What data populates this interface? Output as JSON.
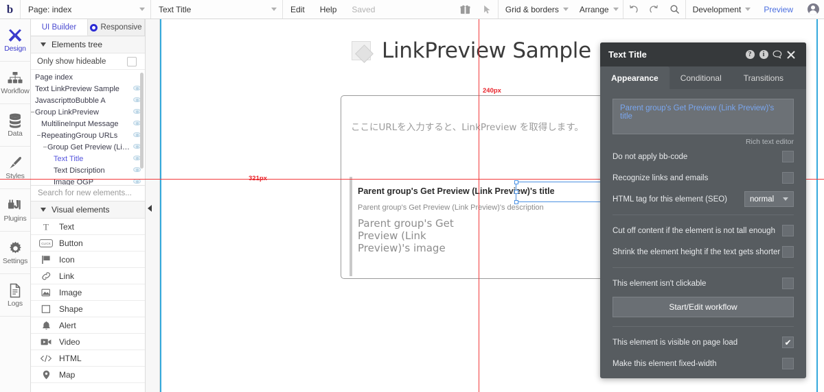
{
  "topbar": {
    "logo": "b",
    "page_select": "Page: index",
    "element_select": "Text Title",
    "edit": "Edit",
    "help": "Help",
    "saved": "Saved",
    "gift_icon": "gift-icon",
    "pointer_icon": "pointer-icon",
    "grid_borders": "Grid & borders",
    "arrange": "Arrange",
    "undo_icon": "undo-icon",
    "redo_icon": "redo-icon",
    "search_icon": "search-icon",
    "version": "Development",
    "preview": "Preview",
    "avatar": "user-avatar"
  },
  "rail": {
    "items": [
      {
        "label": "Design",
        "icon": "design-tools-icon",
        "active": true
      },
      {
        "label": "Workflow",
        "icon": "workflow-icon",
        "active": false
      },
      {
        "label": "Data",
        "icon": "database-icon",
        "active": false
      },
      {
        "label": "Styles",
        "icon": "paintbrush-icon",
        "active": false
      },
      {
        "label": "Plugins",
        "icon": "plug-icon",
        "active": false
      },
      {
        "label": "Settings",
        "icon": "gear-icon",
        "active": false
      },
      {
        "label": "Logs",
        "icon": "document-icon",
        "active": false
      }
    ]
  },
  "left_panel": {
    "tabs": [
      {
        "label": "UI Builder",
        "active": true
      },
      {
        "label": "Responsive",
        "active": false
      }
    ],
    "elements_tree_header": "Elements tree",
    "only_show_hideable": "Only show hideable",
    "tree": [
      {
        "label": "Page index",
        "depth": 0,
        "dash": false,
        "eye": false,
        "selected": false
      },
      {
        "label": "Text LinkPreview Sample",
        "depth": 0,
        "dash": false,
        "eye": true,
        "selected": false
      },
      {
        "label": "JavascripttoBubble A",
        "depth": 0,
        "dash": false,
        "eye": true,
        "selected": false
      },
      {
        "label": "Group LinkPreview",
        "depth": 0,
        "dash": true,
        "eye": true,
        "selected": false
      },
      {
        "label": "MultilineInput Message",
        "depth": 1,
        "dash": false,
        "eye": true,
        "selected": false
      },
      {
        "label": "RepeatingGroup URLs",
        "depth": 1,
        "dash": true,
        "eye": true,
        "selected": false
      },
      {
        "label": "Group Get Preview (Lin...",
        "depth": 2,
        "dash": true,
        "eye": true,
        "selected": false
      },
      {
        "label": "Text Title",
        "depth": 3,
        "dash": false,
        "eye": true,
        "selected": true
      },
      {
        "label": "Text Discription",
        "depth": 3,
        "dash": false,
        "eye": true,
        "selected": false
      },
      {
        "label": "Image OGP",
        "depth": 3,
        "dash": false,
        "eye": true,
        "selected": false
      }
    ],
    "search_placeholder": "Search for new elements...",
    "visual_elements_header": "Visual elements",
    "visual_elements": [
      {
        "label": "Text",
        "icon": "text-icon"
      },
      {
        "label": "Button",
        "icon": "button-icon"
      },
      {
        "label": "Icon",
        "icon": "flag-icon"
      },
      {
        "label": "Link",
        "icon": "link-icon"
      },
      {
        "label": "Image",
        "icon": "image-icon"
      },
      {
        "label": "Shape",
        "icon": "shape-icon"
      },
      {
        "label": "Alert",
        "icon": "bell-icon"
      },
      {
        "label": "Video",
        "icon": "video-icon"
      },
      {
        "label": "HTML",
        "icon": "code-icon"
      },
      {
        "label": "Map",
        "icon": "map-pin-icon"
      }
    ]
  },
  "canvas": {
    "page_title": "LinkPreview Sample",
    "page_title_icon": "image-placeholder-icon",
    "url_input_placeholder": "ここにURLを入力すると、LinkPreview を取得します。",
    "preview_title": "Parent group's Get Preview (Link Preview)'s title",
    "preview_description": "Parent group's Get Preview (Link Preview)'s description",
    "preview_image_text": "Parent group's Get Preview (Link Preview)'s image",
    "guide_vertical_label": "240px",
    "guide_horizontal_label": "321px",
    "guide_color": "#f2383a",
    "edge_color": "#34a9dc"
  },
  "property_panel": {
    "title": "Text Title",
    "header_icons": [
      "help-circle-icon",
      "info-circle-icon",
      "comment-icon",
      "close-icon"
    ],
    "tabs": [
      {
        "label": "Appearance",
        "active": true
      },
      {
        "label": "Conditional",
        "active": false
      },
      {
        "label": "Transitions",
        "active": false
      }
    ],
    "rich_text_value": "Parent group's Get Preview (Link Preview)'s title",
    "rich_text_caption": "Rich text editor",
    "options": [
      {
        "label": "Do not apply bb-code",
        "checked": false
      },
      {
        "label": "Recognize links and emails",
        "checked": false
      }
    ],
    "html_tag_label": "HTML tag for this element (SEO)",
    "html_tag_value": "normal",
    "options2": [
      {
        "label": "Cut off content if the element is not tall enough",
        "checked": false
      },
      {
        "label": "Shrink the element height if the text gets shorter",
        "checked": false
      }
    ],
    "not_clickable_label": "This element isn't clickable",
    "not_clickable_checked": false,
    "workflow_button": "Start/Edit workflow",
    "options3": [
      {
        "label": "This element is visible on page load",
        "checked": true
      },
      {
        "label": "Make this element fixed-width",
        "checked": false
      }
    ],
    "checkmark": "✔"
  }
}
